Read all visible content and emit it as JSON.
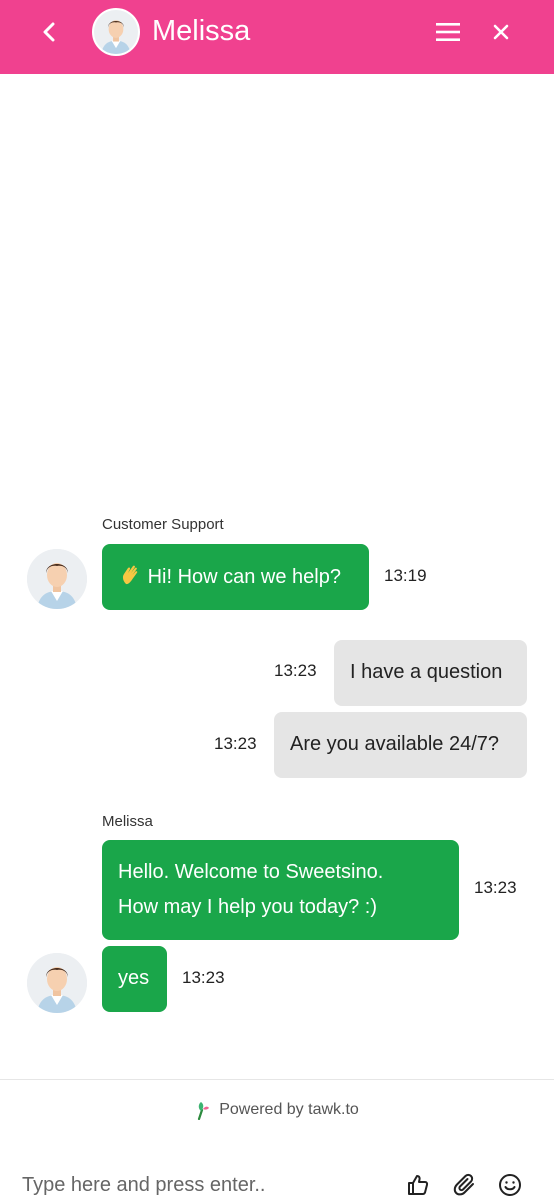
{
  "header": {
    "agent_name": "Melissa",
    "back_icon": "chevron-left-icon",
    "menu_icon": "hamburger-menu-icon",
    "close_icon": "close-icon",
    "bg_color": "#f0418f"
  },
  "messages": [
    {
      "sender_label": "Customer Support",
      "direction": "in",
      "emoji": "waving-hand",
      "text": "Hi! How can we help?",
      "time": "13:19"
    },
    {
      "direction": "out",
      "text": "I have a question",
      "time": "13:23"
    },
    {
      "direction": "out",
      "text": "Are you available 24/7?",
      "time": "13:23"
    },
    {
      "sender_label": "Melissa",
      "direction": "in",
      "lines": [
        "Hello. Welcome to Sweetsino.",
        "How may I help you today? :)"
      ],
      "time": "13:23"
    },
    {
      "direction": "in",
      "text": "yes",
      "time": "13:23"
    }
  ],
  "footer": {
    "powered_text": "Powered by tawk.to",
    "input_placeholder": "Type here and press enter..",
    "icons": [
      "thumbs-up-icon",
      "paperclip-icon",
      "emoji-icon"
    ]
  },
  "colors": {
    "incoming_bubble": "#1aa64a",
    "outgoing_bubble": "#e5e5e5",
    "accent": "#f0418f"
  }
}
